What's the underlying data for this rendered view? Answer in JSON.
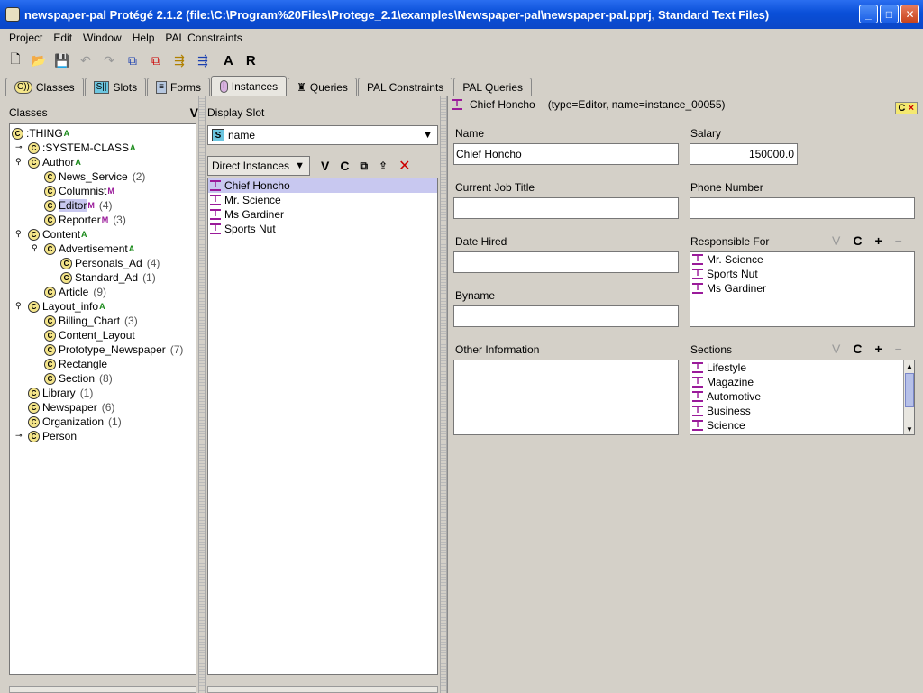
{
  "window": {
    "title": "newspaper-pal  Protégé 2.1.2     (file:\\C:\\Program%20Files\\Protege_2.1\\examples\\Newspaper-pal\\newspaper-pal.pprj, Standard Text Files)"
  },
  "menu": [
    "Project",
    "Edit",
    "Window",
    "Help",
    "PAL Constraints"
  ],
  "toolbar": {
    "text_a": "A",
    "text_r": "R"
  },
  "tabs": [
    {
      "label": "Classes",
      "icon": "C))"
    },
    {
      "label": "Slots",
      "icon": "S||"
    },
    {
      "label": "Forms",
      "icon": "≡"
    },
    {
      "label": "Instances",
      "icon": "I"
    },
    {
      "label": "Queries",
      "icon": "♜"
    },
    {
      "label": "PAL Constraints",
      "icon": ""
    },
    {
      "label": "PAL Queries",
      "icon": ""
    }
  ],
  "classes_pane": {
    "header": "Classes",
    "v_button": "V",
    "tree": [
      {
        "label": ":THING",
        "badge": "A",
        "count": ""
      },
      {
        "label": ":SYSTEM-CLASS",
        "badge": "A",
        "count": ""
      },
      {
        "label": "Author",
        "badge": "A",
        "count": ""
      },
      {
        "label": "News_Service",
        "badge": "",
        "count": "(2)"
      },
      {
        "label": "Columnist",
        "badge": "M",
        "count": ""
      },
      {
        "label": "Editor",
        "badge": "M",
        "count": "(4)"
      },
      {
        "label": "Reporter",
        "badge": "M",
        "count": "(3)"
      },
      {
        "label": "Content",
        "badge": "A",
        "count": ""
      },
      {
        "label": "Advertisement",
        "badge": "A",
        "count": ""
      },
      {
        "label": "Personals_Ad",
        "badge": "",
        "count": "(4)"
      },
      {
        "label": "Standard_Ad",
        "badge": "",
        "count": "(1)"
      },
      {
        "label": "Article",
        "badge": "",
        "count": "(9)"
      },
      {
        "label": "Layout_info",
        "badge": "A",
        "count": ""
      },
      {
        "label": "Billing_Chart",
        "badge": "",
        "count": "(3)"
      },
      {
        "label": "Content_Layout",
        "badge": "",
        "count": ""
      },
      {
        "label": "Prototype_Newspaper",
        "badge": "",
        "count": "(7)"
      },
      {
        "label": "Rectangle",
        "badge": "",
        "count": ""
      },
      {
        "label": "Section",
        "badge": "",
        "count": "(8)"
      },
      {
        "label": "Library",
        "badge": "",
        "count": "(1)"
      },
      {
        "label": "Newspaper",
        "badge": "",
        "count": "(6)"
      },
      {
        "label": "Organization",
        "badge": "",
        "count": "(1)"
      },
      {
        "label": "Person",
        "badge": "",
        "count": ""
      }
    ]
  },
  "instances_pane": {
    "display_slot_label": "Display Slot",
    "slot_value": "name",
    "direct_instances": "Direct Instances",
    "btn_v": "V",
    "btn_c": "C",
    "instances": [
      "Chief Honcho",
      "Mr. Science",
      "Ms Gardiner",
      "Sports Nut"
    ]
  },
  "form": {
    "title": "Chief Honcho",
    "title_meta": "(type=Editor, name=instance_00055)",
    "badge_c": "C",
    "badge_x": "×",
    "name_label": "Name",
    "name_value": "Chief Honcho",
    "salary_label": "Salary",
    "salary_value": "150000.0",
    "job_label": "Current Job Title",
    "phone_label": "Phone Number",
    "date_label": "Date Hired",
    "responsible_label": "Responsible For",
    "responsible_items": [
      "Mr. Science",
      "Sports Nut",
      "Ms Gardiner"
    ],
    "byname_label": "Byname",
    "other_label": "Other Information",
    "sections_label": "Sections",
    "sections_items": [
      "Lifestyle",
      "Magazine",
      "Automotive",
      "Business",
      "Science"
    ],
    "btn_v": "V",
    "btn_c": "C",
    "btn_plus": "+",
    "btn_minus": "−"
  }
}
